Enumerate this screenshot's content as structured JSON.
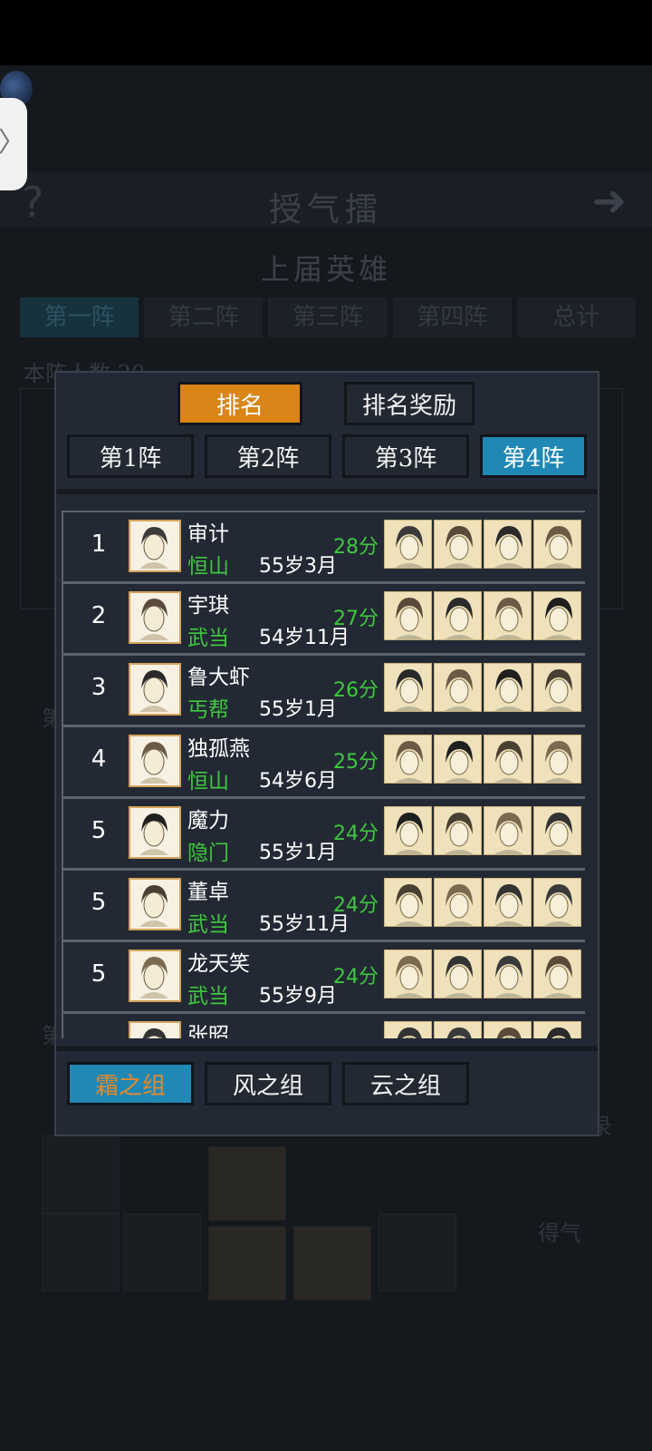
{
  "background": {
    "title": "授气擂",
    "subtitle": "上届英雄",
    "tabs": [
      "第一阵",
      "第二阵",
      "第三阵",
      "第四阵",
      "总计"
    ],
    "note": "本阵人数 20",
    "side_label_1": "第",
    "side_label_2": "第",
    "right_label_1": "录",
    "right_label_2": "得气"
  },
  "modal": {
    "tabs": [
      {
        "label": "排名",
        "active": true
      },
      {
        "label": "排名奖励",
        "active": false
      }
    ],
    "formations": [
      {
        "label": "第1阵",
        "active": false
      },
      {
        "label": "第2阵",
        "active": false
      },
      {
        "label": "第3阵",
        "active": false
      },
      {
        "label": "第4阵",
        "active": true
      }
    ],
    "rows": [
      {
        "rank": "1",
        "name": "审计",
        "sect": "恒山",
        "age": "55岁3月",
        "score": "28分"
      },
      {
        "rank": "2",
        "name": "宇琪",
        "sect": "武当",
        "age": "54岁11月",
        "score": "27分"
      },
      {
        "rank": "3",
        "name": "鲁大虾",
        "sect": "丐帮",
        "age": "55岁1月",
        "score": "26分"
      },
      {
        "rank": "4",
        "name": "独孤燕",
        "sect": "恒山",
        "age": "54岁6月",
        "score": "25分"
      },
      {
        "rank": "5",
        "name": "魔力",
        "sect": "隐门",
        "age": "55岁1月",
        "score": "24分"
      },
      {
        "rank": "5",
        "name": "董卓",
        "sect": "武当",
        "age": "55岁11月",
        "score": "24分"
      },
      {
        "rank": "5",
        "name": "龙天笑",
        "sect": "武当",
        "age": "55岁9月",
        "score": "24分"
      },
      {
        "rank": "",
        "name": "张昭",
        "sect": "",
        "age": "",
        "score": ""
      }
    ],
    "groups": [
      {
        "label": "霜之组",
        "active": true
      },
      {
        "label": "风之组",
        "active": false
      },
      {
        "label": "云之组",
        "active": false
      }
    ]
  },
  "colors": {
    "active_orange": "#d98518",
    "active_blue": "#1f88b5",
    "sect_green": "#3ec83e",
    "group_active_text": "#e08a2c"
  }
}
